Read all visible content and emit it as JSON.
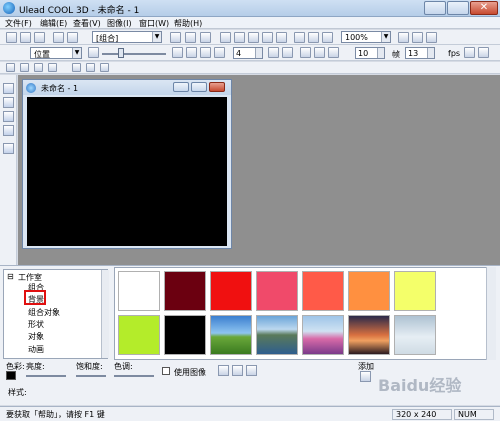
{
  "window": {
    "title": "Ulead COOL 3D - 未命名 - 1"
  },
  "menu": [
    "文件(F)",
    "编辑(E)",
    "查看(V)",
    "图像(I)",
    "窗口(W)",
    "帮助(H)"
  ],
  "toolbar1": {
    "group_combo": "[组合]",
    "zoom_combo": "100%"
  },
  "toolbar2": {
    "position_combo": "位置",
    "value1": "4",
    "value2": "10",
    "frames_label": "帧",
    "value3": "13",
    "fps_label": "fps"
  },
  "document": {
    "title": "未命名 - 1"
  },
  "tree": {
    "root": "工作室",
    "items": [
      "组合",
      "背景",
      "组合对象",
      "形状",
      "对象",
      "动画"
    ]
  },
  "gallery": {
    "thumbs": [
      {
        "name": "white",
        "color": "#ffffff"
      },
      {
        "name": "dark-red",
        "color": "#6b0010"
      },
      {
        "name": "red",
        "color": "#f01010"
      },
      {
        "name": "pink-red",
        "color": "#f04a6a"
      },
      {
        "name": "coral",
        "color": "#ff5a48"
      },
      {
        "name": "orange",
        "color": "#ff9040"
      },
      {
        "name": "yellow",
        "color": "#f4ff6a"
      },
      {
        "name": "lime",
        "color": "#b4ec2a"
      },
      {
        "name": "black",
        "color": "#000000"
      },
      {
        "name": "sky-field",
        "color": "#4e9ad6"
      },
      {
        "name": "lake-mountain",
        "color": "#4f8fbf"
      },
      {
        "name": "flower-field",
        "color": "#b07ab0"
      },
      {
        "name": "sunset-tree",
        "color": "#d06a40"
      },
      {
        "name": "snow-tree",
        "color": "#c9d8e2"
      }
    ]
  },
  "controls": {
    "color_label": "色彩:",
    "brightness_label": "亮度:",
    "saturation_label": "饱和度:",
    "hue_label": "色调:",
    "use_image_label": "使用图像",
    "add_label": "添加",
    "style_label": "样式:"
  },
  "status": {
    "help": "要获取「帮助」，请按 F1 键",
    "size": "320 x 240",
    "num": "NUM"
  },
  "watermark": "Baidu经验"
}
